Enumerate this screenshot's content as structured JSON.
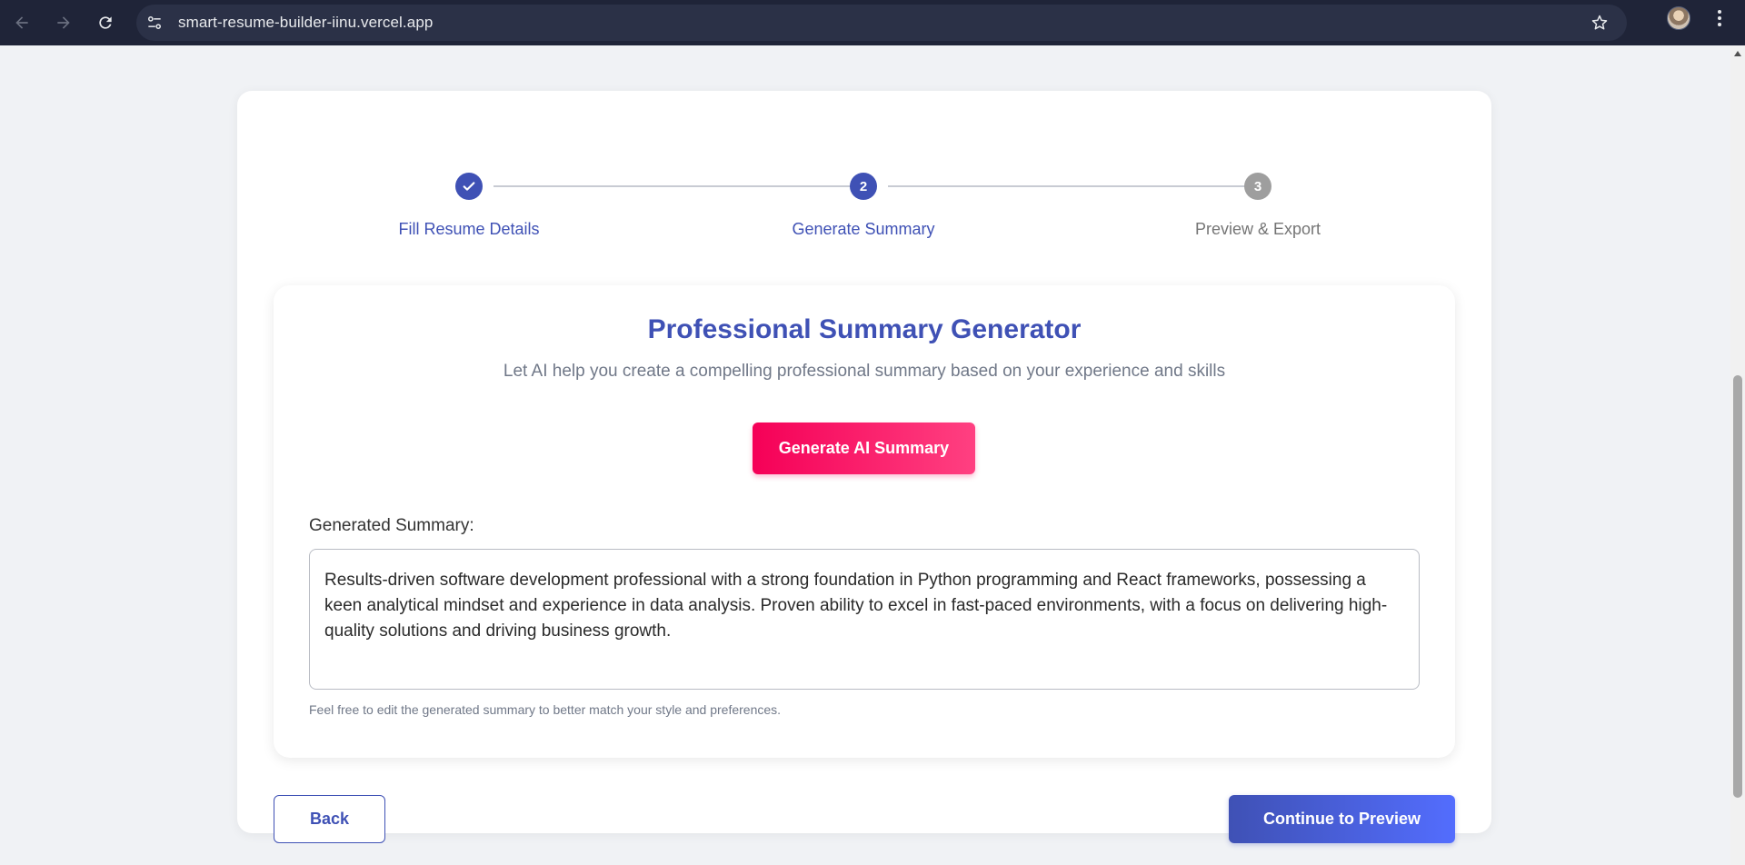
{
  "browser": {
    "url": "smart-resume-builder-iinu.vercel.app",
    "icons": {
      "back": "arrow-left-icon",
      "forward": "arrow-right-icon",
      "reload": "reload-icon",
      "site_info": "tune-icon",
      "bookmark": "star-icon",
      "menu": "kebab-icon"
    }
  },
  "stepper": {
    "steps": [
      {
        "number": "1",
        "label": "Fill Resume Details",
        "state": "completed"
      },
      {
        "number": "2",
        "label": "Generate Summary",
        "state": "active"
      },
      {
        "number": "3",
        "label": "Preview & Export",
        "state": "pending"
      }
    ]
  },
  "summary_panel": {
    "title": "Professional Summary Generator",
    "subtitle": "Let AI help you create a compelling professional summary based on your experience and skills",
    "generate_button": "Generate AI Summary",
    "field_label": "Generated Summary:",
    "summary_text": "Results-driven software development professional with a strong foundation in Python programming and React frameworks, possessing a keen analytical mindset and experience in data analysis. Proven ability to excel in fast-paced environments, with a focus on delivering high-quality solutions and driving business growth.",
    "hint": "Feel free to edit the generated summary to better match your style and preferences."
  },
  "actions": {
    "back": "Back",
    "continue": "Continue to Preview"
  },
  "colors": {
    "primary": "#3f51b5",
    "accent": "#f50057",
    "chrome": "#1f2438"
  }
}
